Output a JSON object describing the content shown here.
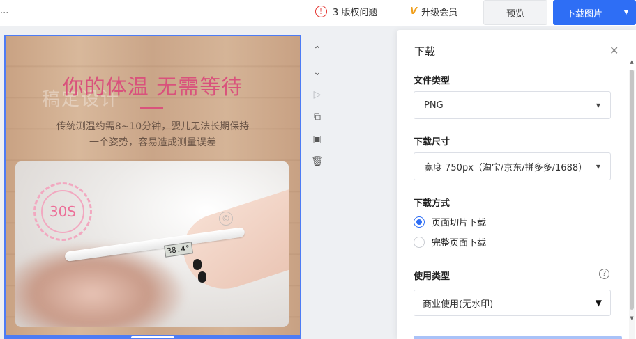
{
  "topbar": {
    "ellipsis": "...",
    "issues_label": "3 版权问题",
    "issues_icon": "!",
    "vip_label": "升级会员",
    "vip_icon": "V",
    "preview_label": "预览",
    "download_label": "下载图片",
    "download_arrow": "▼"
  },
  "canvas": {
    "watermark": "稿定设计",
    "headline": "你的体温 无需等待",
    "sub_line1": "传统测温约需8~10分钟，婴儿无法长期保持",
    "sub_line2": "一个姿势，容易造成测量误差",
    "timer_text": "30S",
    "lcd_text": "38.4°",
    "copyright_mark": "©"
  },
  "tools": {
    "up": "⌃",
    "down": "⌄",
    "play": "▷",
    "copy": "⧉",
    "image": "▣",
    "delete": "🗑"
  },
  "panel": {
    "title": "下载",
    "close": "✕",
    "file_type_label": "文件类型",
    "file_type_value": "PNG",
    "size_label": "下载尺寸",
    "size_value": "宽度 750px（淘宝/京东/拼多多/1688）",
    "method_label": "下载方式",
    "method_options": [
      "页面切片下载",
      "完整页面下载"
    ],
    "method_selected": 0,
    "usage_label": "使用类型",
    "usage_help": "?",
    "usage_value": "商业使用(无水印)",
    "caret": "▼"
  },
  "colors": {
    "accent": "#2e6ef5",
    "headline": "#d9527c",
    "warning": "#e53935",
    "vip": "#f0a01e"
  }
}
